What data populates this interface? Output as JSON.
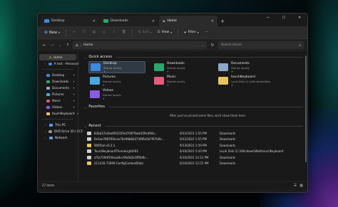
{
  "window": {
    "tabs": [
      {
        "label": "Desktop",
        "color": "#3a8be0",
        "active": false
      },
      {
        "label": "Downloads",
        "color": "#2aa86b",
        "active": false
      },
      {
        "label": "Home",
        "color": "#f0f0f0",
        "active": true
      }
    ],
    "new_tab": "+",
    "controls": {
      "minimize": "—",
      "maximize": "☐",
      "close": "✕"
    }
  },
  "toolbar": {
    "new_label": "New",
    "sort_label": "Sort",
    "view_label": "View",
    "filter_label": "Filter",
    "more": "···"
  },
  "addressbar": {
    "path": "Home",
    "search_placeholder": "Search Home"
  },
  "sidebar": {
    "items": [
      {
        "label": "Home",
        "color": "#e8c45a",
        "active": true
      },
      {
        "label": "A test - Personal",
        "color": "#3a8be0",
        "active": false
      },
      {
        "label": "Desktop",
        "color": "#3a8be0",
        "pinned": true
      },
      {
        "label": "Downloads",
        "color": "#2aa86b",
        "pinned": true
      },
      {
        "label": "Documents",
        "color": "#8aa8c8",
        "pinned": true
      },
      {
        "label": "Pictures",
        "color": "#4aa8e0",
        "pinned": true
      },
      {
        "label": "Music",
        "color": "#e85a7a",
        "pinned": true
      },
      {
        "label": "Videos",
        "color": "#8a5ae0",
        "pinned": true
      },
      {
        "label": "touchKeyboard",
        "color": "#e8c45a",
        "pinned": true
      },
      {
        "label": "This PC",
        "color": "#5a9ae0"
      },
      {
        "label": "DVD Drive (D:) CCC",
        "color": "#9a9a9a"
      },
      {
        "label": "Network",
        "color": "#5a9ae0"
      }
    ]
  },
  "quick_access": {
    "title": "Quick access",
    "items": [
      {
        "name": "Desktop",
        "sub": "Stored locally",
        "color": "#3a8be0",
        "selected": true
      },
      {
        "name": "Downloads",
        "sub": "Stored locally",
        "color": "#2aa86b"
      },
      {
        "name": "Documents",
        "sub": "Stored locally",
        "color": "#8aa8c8"
      },
      {
        "name": "Pictures",
        "sub": "Stored locally",
        "color": "#4aa8e0"
      },
      {
        "name": "Music",
        "sub": "Stored locally",
        "color": "#e85a7a"
      },
      {
        "name": "touchKeyboard",
        "sub": "Local Disk (C:)\\Windows\\Web",
        "color": "#e8c45a"
      },
      {
        "name": "Videos",
        "sub": "Stored locally",
        "color": "#8a5ae0"
      }
    ]
  },
  "favorites": {
    "title": "Favorites",
    "empty_text": "After you've pinned some files, we'll show them here."
  },
  "recent": {
    "title": "Recent",
    "rows": [
      {
        "name": "83bb37e2ba6f0332fad704f7bab359cd9da...",
        "date": "9/22/2022 1:55 PM",
        "loc": "Downloads",
        "color": "#cfcfcf"
      },
      {
        "name": "0e3ae7865f00cae76e96b6b3739f6a5b7f67b0e...",
        "date": "9/22/2022 1:55 PM",
        "loc": "Downloads",
        "color": "#cfcfcf"
      },
      {
        "name": "WiltTool-v0.2.1",
        "date": "9/13/2022 1:59 PM",
        "loc": "Downloads",
        "color": "#e8c45a"
      },
      {
        "name": "TouchKeyboardThemeLight003",
        "date": "6/10/2022 5:43 PM",
        "loc": "Local Disk (C:)\\Windows\\Web\\touchKeyboard",
        "color": "#cfcfcf"
      },
      {
        "name": "cf5a739df1f4ead4cc9fa0d2c4ff0d0c...",
        "date": "6/10/2022 12:13 PM",
        "loc": "Downloads",
        "color": "#cfcfcf"
      },
      {
        "name": "211126-73490-ConfigContextData",
        "date": "6/10/2022 12:25 PM",
        "loc": "Downloads",
        "color": "#e8c45a"
      }
    ]
  },
  "status": {
    "count": "27 items"
  }
}
